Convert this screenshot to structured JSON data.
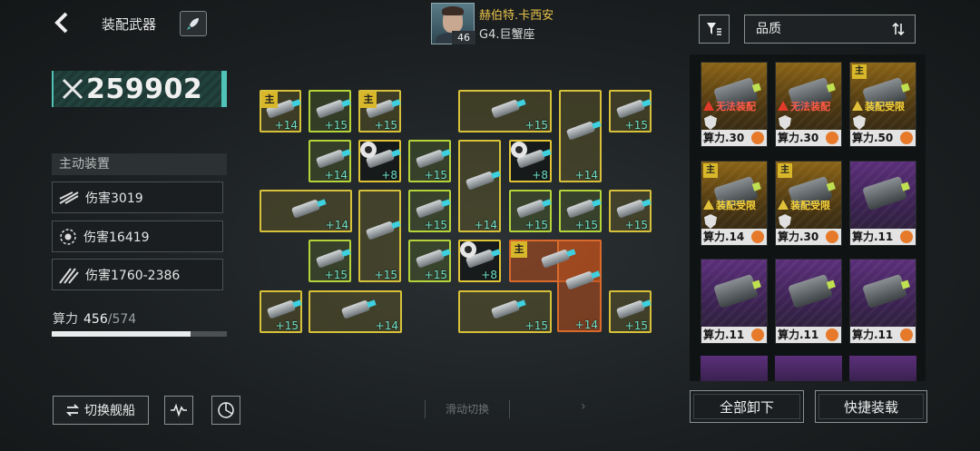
{
  "header": {
    "title": "装配武器",
    "pilot": {
      "name": "赫伯特.卡西安",
      "sub": "G4.巨蟹座",
      "level": "46"
    }
  },
  "power": {
    "value": "259902"
  },
  "active_section": {
    "title": "主动装置",
    "stats": [
      {
        "label": "伤害3019"
      },
      {
        "label": "伤害16419"
      },
      {
        "label": "伤害1760-2386"
      }
    ]
  },
  "capacity": {
    "label": "算力",
    "current": "456",
    "max": "/574",
    "fill_fraction": 0.795
  },
  "buttons": {
    "switch_ship": "切换舰船",
    "unequip_all": "全部卸下",
    "quick_equip": "快捷装载"
  },
  "hint": "滑动切换",
  "filter": {
    "quality_label": "品质"
  },
  "grid_slots": [
    {
      "lvl": "+14",
      "main": "主"
    },
    {
      "lvl": "+15"
    },
    {
      "lvl": "+15",
      "main": "主"
    },
    {
      "lvl": "+15"
    },
    {
      "lvl": "+14"
    },
    {
      "lvl": "+15"
    },
    {
      "lvl": "+14"
    },
    {
      "lvl": "+8",
      "gear": true
    },
    {
      "lvl": "+15"
    },
    {
      "lvl": "+14"
    },
    {
      "lvl": "+8",
      "gear": true
    },
    {
      "lvl": "+14"
    },
    {
      "lvl": "+15"
    },
    {
      "lvl": "+15"
    },
    {
      "lvl": "+15"
    },
    {
      "lvl": "+15"
    },
    {
      "lvl": "+15"
    },
    {
      "lvl": "+15"
    },
    {
      "lvl": "+15"
    },
    {
      "lvl": "+8",
      "gear": true
    },
    {
      "main": "主"
    },
    {
      "lvl": "+14"
    },
    {
      "lvl": "+15"
    },
    {
      "lvl": "+14"
    },
    {
      "lvl": "+15"
    },
    {
      "lvl": "+15"
    }
  ],
  "inventory": [
    {
      "theme": "orange",
      "warning": "无法装配",
      "warn_type": "red",
      "power": "算力.30"
    },
    {
      "theme": "orange",
      "warning": "无法装配",
      "warn_type": "red",
      "power": "算力.30"
    },
    {
      "theme": "orange",
      "main": "主",
      "warning": "装配受限",
      "warn_type": "yel",
      "power": "算力.50"
    },
    {
      "theme": "orange",
      "main": "主",
      "warning": "装配受限",
      "warn_type": "yel",
      "power": "算力.14"
    },
    {
      "theme": "orange",
      "main": "主",
      "warning": "装配受限",
      "warn_type": "yel",
      "power": "算力.30"
    },
    {
      "theme": "purple",
      "power": "算力.11"
    },
    {
      "theme": "purple",
      "power": "算力.11"
    },
    {
      "theme": "purple",
      "power": "算力.11"
    },
    {
      "theme": "purple",
      "power": "算力.11"
    }
  ],
  "colors": {
    "accent": "#4fc3b5",
    "slot_yellow": "#d8c13a",
    "slot_green": "#b6d43a",
    "slot_red": "#d96a2c",
    "pilot_name": "#e9c24a"
  }
}
